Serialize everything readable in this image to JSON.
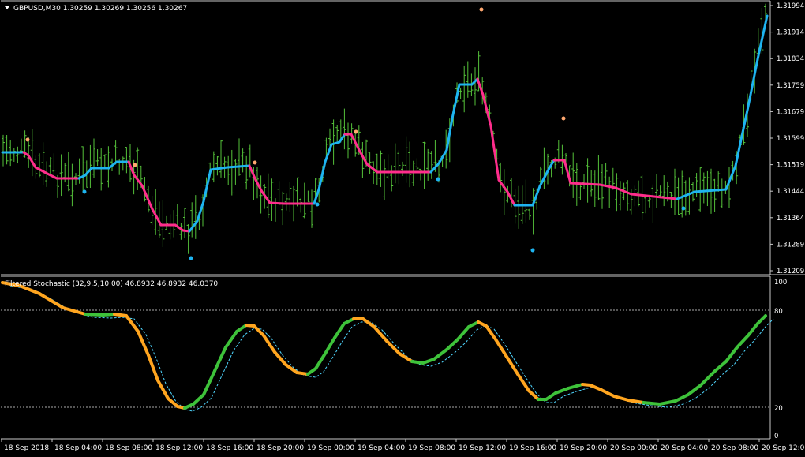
{
  "main_pane": {
    "symbol_text": "GBPUSD,M30  1.30259 1.30269 1.30256 1.30267",
    "price_labels": [
      "1.31994",
      "1.31914",
      "1.31834",
      "1.31759",
      "1.31679",
      "1.31599",
      "1.31519",
      "1.31444",
      "1.31364",
      "1.31289",
      "1.31209"
    ]
  },
  "indicator_pane": {
    "header_text": "Filtered Stochastic (32,9,5,10.00) 46.8932 46.8932 46.0370",
    "level_labels": [
      "100",
      "80",
      "20",
      "0"
    ]
  },
  "time_labels": [
    "18 Sep 2018",
    "18 Sep 04:00",
    "18 Sep 08:00",
    "18 Sep 12:00",
    "18 Sep 16:00",
    "18 Sep 20:00",
    "19 Sep 00:00",
    "19 Sep 04:00",
    "19 Sep 08:00",
    "19 Sep 12:00",
    "19 Sep 16:00",
    "19 Sep 20:00",
    "20 Sep 00:00",
    "20 Sep 04:00",
    "20 Sep 08:00",
    "20 Sep 12:00"
  ],
  "colors": {
    "background": "#000000",
    "bars": "#55c23a",
    "trend_up": "#1eb4f0",
    "trend_down": "#ff2d8c",
    "dot_up": "#1eb4f0",
    "dot_down": "#ffa870",
    "stoch_up": "#3ec23a",
    "stoch_down": "#ffa51f",
    "signal": "#4fd6ff",
    "border": "#c8c8c8",
    "level_line": "#aaaaaa"
  }
}
